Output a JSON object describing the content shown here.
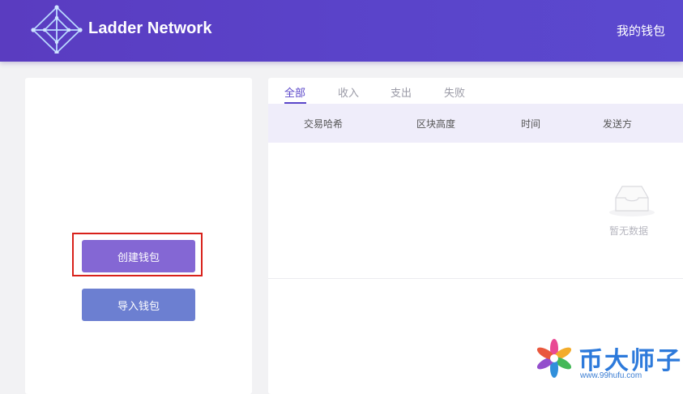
{
  "header": {
    "brand": "Ladder Network",
    "my_wallet": "我的钱包"
  },
  "left": {
    "create_wallet": "创建钱包",
    "import_wallet": "导入钱包"
  },
  "tabs": [
    {
      "label": "全部",
      "active": true
    },
    {
      "label": "收入",
      "active": false
    },
    {
      "label": "支出",
      "active": false
    },
    {
      "label": "失败",
      "active": false
    }
  ],
  "table": {
    "columns": [
      "交易哈希",
      "区块高度",
      "时间",
      "发送方"
    ]
  },
  "empty": {
    "text": "暂无数据"
  },
  "colors": {
    "brand": "#5a3cc0",
    "create_button": "#8467d4",
    "import_button": "#6c7fd1",
    "highlight_border": "#d8211b"
  },
  "watermark": {
    "text": "币大师子",
    "url": "www.99hufu.com"
  }
}
